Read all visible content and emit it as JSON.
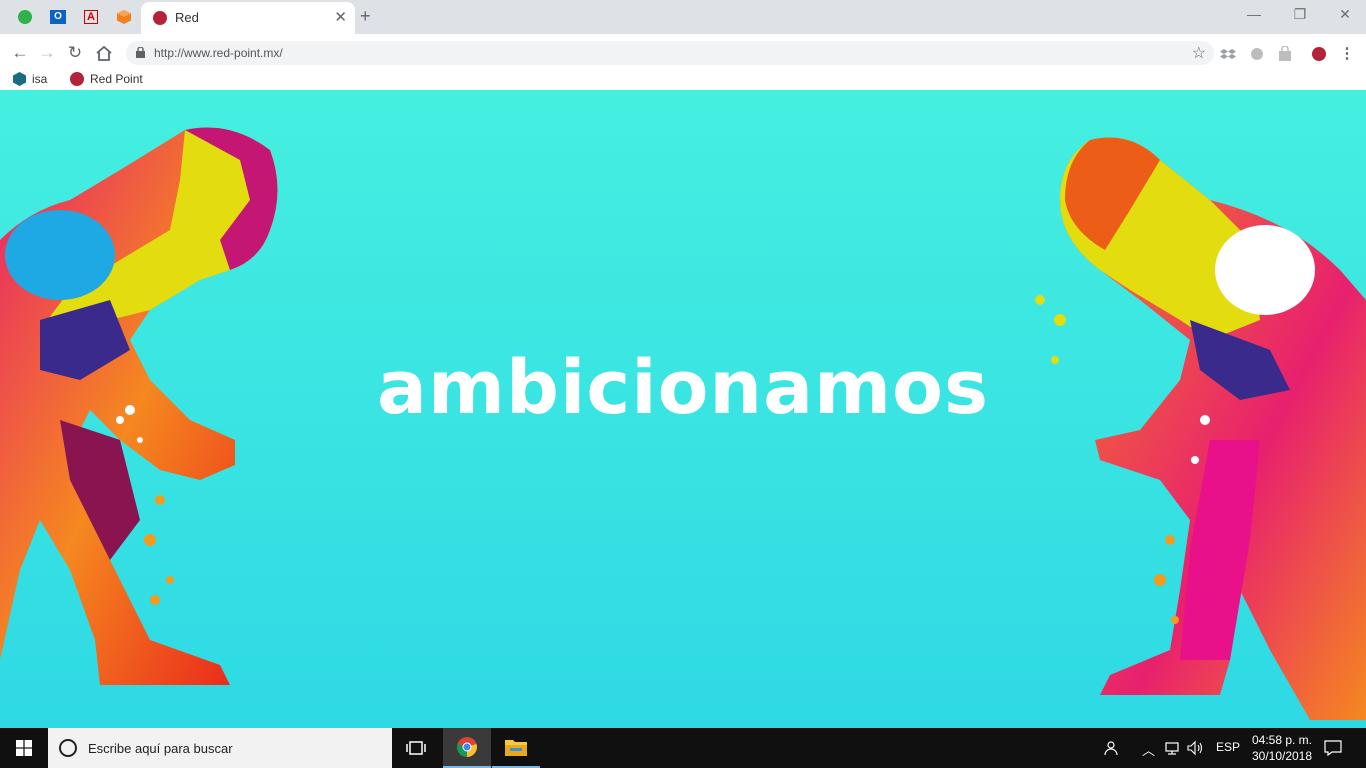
{
  "browser": {
    "tab_title": "Red",
    "url": "http://www.red-point.mx/",
    "bookmarks": [
      {
        "label": "isa"
      },
      {
        "label": "Red Point"
      }
    ]
  },
  "page": {
    "hero_text": "ambicionamos"
  },
  "taskbar": {
    "search_placeholder": "Escribe aquí para buscar",
    "language": "ESP",
    "time": "04:58 p. m.",
    "date": "30/10/2018"
  },
  "colors": {
    "brand_red": "#b3233a",
    "page_top": "#45efe0",
    "page_bottom": "#2ed9e4"
  }
}
